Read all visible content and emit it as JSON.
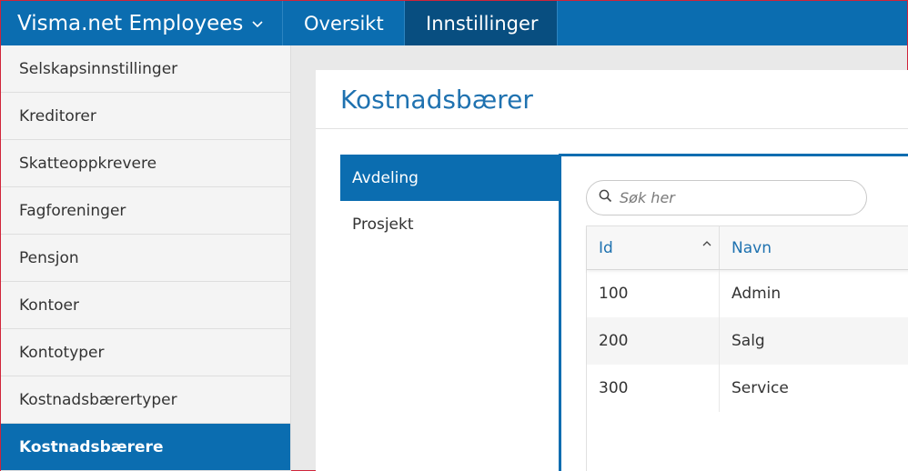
{
  "topbar": {
    "app_title": "Visma.net Employees",
    "nav": [
      "Oversikt",
      "Innstillinger"
    ],
    "active_nav": "Innstillinger"
  },
  "sidebar": {
    "items": [
      {
        "label": "Selskapsinnstillinger"
      },
      {
        "label": "Kreditorer"
      },
      {
        "label": "Skatteoppkrevere"
      },
      {
        "label": "Fagforeninger"
      },
      {
        "label": "Pensjon"
      },
      {
        "label": "Kontoer"
      },
      {
        "label": "Kontotyper"
      },
      {
        "label": "Kostnadsbærertyper"
      },
      {
        "label": "Kostnadsbærere"
      }
    ],
    "active_item": "Kostnadsbærere"
  },
  "main": {
    "title": "Kostnadsbærer",
    "tabs": [
      {
        "label": "Avdeling"
      },
      {
        "label": "Prosjekt"
      }
    ],
    "active_tab": "Avdeling",
    "search": {
      "placeholder": "Søk her",
      "value": ""
    },
    "table": {
      "columns": [
        "Id",
        "Navn"
      ],
      "sorted_column": "Id",
      "sort_direction": "ascending",
      "rows": [
        {
          "id": "100",
          "navn": "Admin"
        },
        {
          "id": "200",
          "navn": "Salg"
        },
        {
          "id": "300",
          "navn": "Service"
        }
      ]
    }
  },
  "colors": {
    "primary": "#0b6db0",
    "primary_dark": "#084e80",
    "link_text": "#1f72b0"
  },
  "icons": {
    "brand_dropdown": "chevron-down-icon",
    "search": "search-icon",
    "sort": "sort-ascending-icon"
  }
}
